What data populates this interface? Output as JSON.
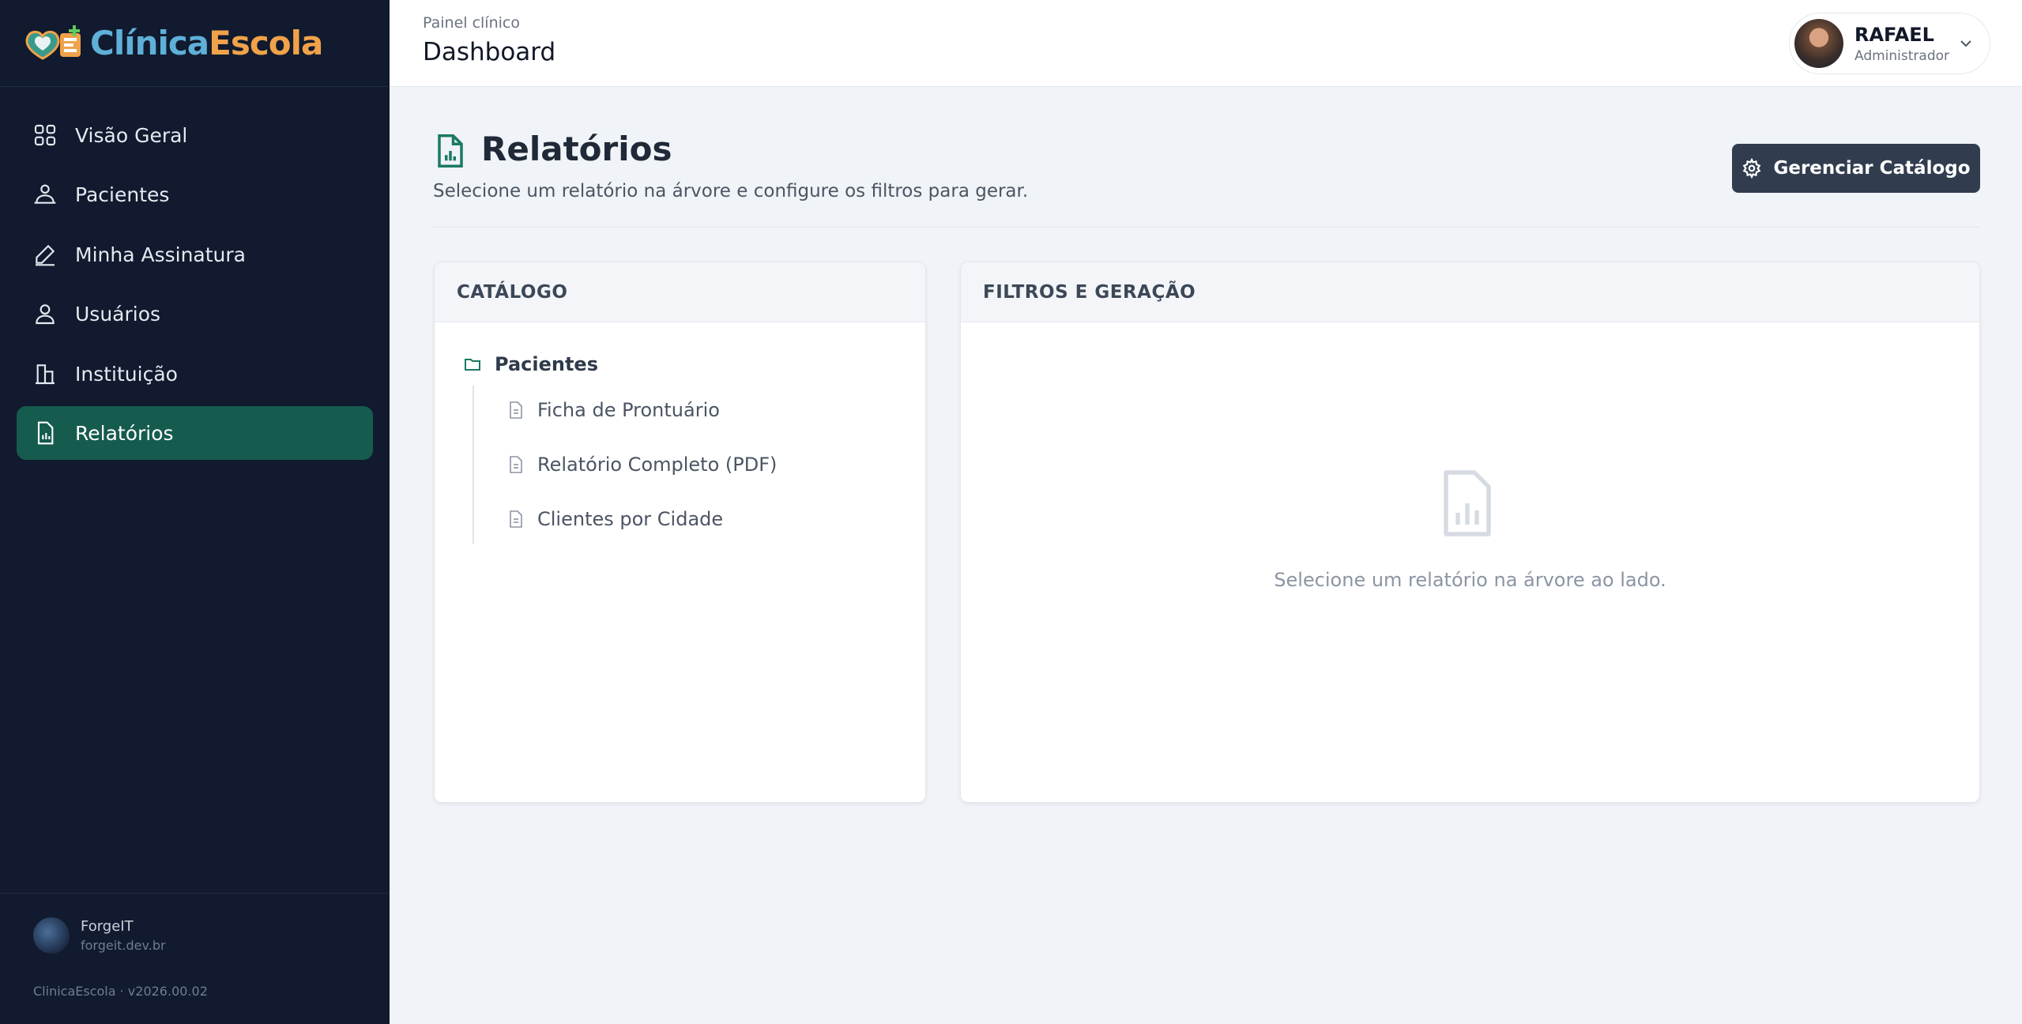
{
  "brand": {
    "part1": "Clínica",
    "part2": "Escola"
  },
  "sidebar": {
    "items": [
      {
        "label": "Visão Geral",
        "icon": "grid-icon",
        "active": false
      },
      {
        "label": "Pacientes",
        "icon": "patients-icon",
        "active": false
      },
      {
        "label": "Minha Assinatura",
        "icon": "pen-icon",
        "active": false
      },
      {
        "label": "Usuários",
        "icon": "user-icon",
        "active": false
      },
      {
        "label": "Instituição",
        "icon": "building-icon",
        "active": false
      },
      {
        "label": "Relatórios",
        "icon": "report-icon",
        "active": true
      }
    ],
    "footer": {
      "company": "ForgeIT",
      "url": "forgeit.dev.br",
      "version": "ClinicaEscola · v2026.00.02"
    }
  },
  "topbar": {
    "breadcrumb": "Painel clínico",
    "title": "Dashboard",
    "user": {
      "name": "RAFAEL",
      "role": "Administrador"
    }
  },
  "main": {
    "title": "Relatórios",
    "subtitle": "Selecione um relatório na árvore e configure os filtros para gerar.",
    "manage_button": "Gerenciar Catálogo",
    "catalog": {
      "header": "CATÁLOGO",
      "folder": "Pacientes",
      "items": [
        "Ficha de Prontuário",
        "Relatório Completo (PDF)",
        "Clientes por Cidade"
      ]
    },
    "filters": {
      "header": "FILTROS E GERAÇÃO",
      "empty_text": "Selecione um relatório na árvore ao lado."
    }
  },
  "colors": {
    "sidebar_bg": "#111a2e",
    "active_item": "#155b4e",
    "accent": "#1a7a64",
    "button": "#313d4f"
  }
}
